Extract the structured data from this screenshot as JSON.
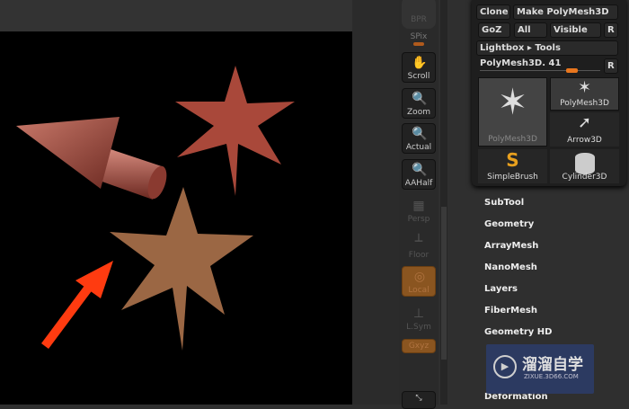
{
  "toolbar": [
    {
      "label": "BPR",
      "icon": "bpr-sphere-icon"
    },
    {
      "label": "SPix"
    },
    {
      "label": "Scroll",
      "icon": "hand-icon"
    },
    {
      "label": "Zoom",
      "icon": "magnifier-icon"
    },
    {
      "label": "Actual",
      "icon": "magnifier-x1-icon"
    },
    {
      "label": "AAHalf",
      "icon": "magnifier-half-icon"
    },
    {
      "label": "Persp",
      "icon": "grid-icon"
    },
    {
      "label": "Floor",
      "icon": "floor-icon"
    },
    {
      "label": "Local",
      "icon": "local-icon"
    },
    {
      "label": "L.Sym",
      "icon": "lsym-icon"
    },
    {
      "label": "Gxyz"
    }
  ],
  "tool_popup": {
    "clone": "Clone",
    "make_polymesh": "Make PolyMesh3D",
    "goz": "GoZ",
    "all": "All",
    "visible": "Visible",
    "r": "R",
    "lightbox": "Lightbox ▸ Tools",
    "current_tool": "PolyMesh3D. 41",
    "slider_value": 0.72,
    "thumbnails": [
      "PolyMesh3D",
      "PolyMesh3D",
      "Arrow3D",
      "SimpleBrush",
      "Cylinder3D"
    ]
  },
  "menu": [
    "SubTool",
    "Geometry",
    "ArrayMesh",
    "NanoMesh",
    "Layers",
    "FiberMesh",
    "Geometry HD",
    "Deformation"
  ],
  "watermark": {
    "title": "溜溜自学",
    "url": "ZIXUE.3D66.COM"
  },
  "colors": {
    "accent": "#e8761e",
    "arrow": "#ff3b10"
  }
}
